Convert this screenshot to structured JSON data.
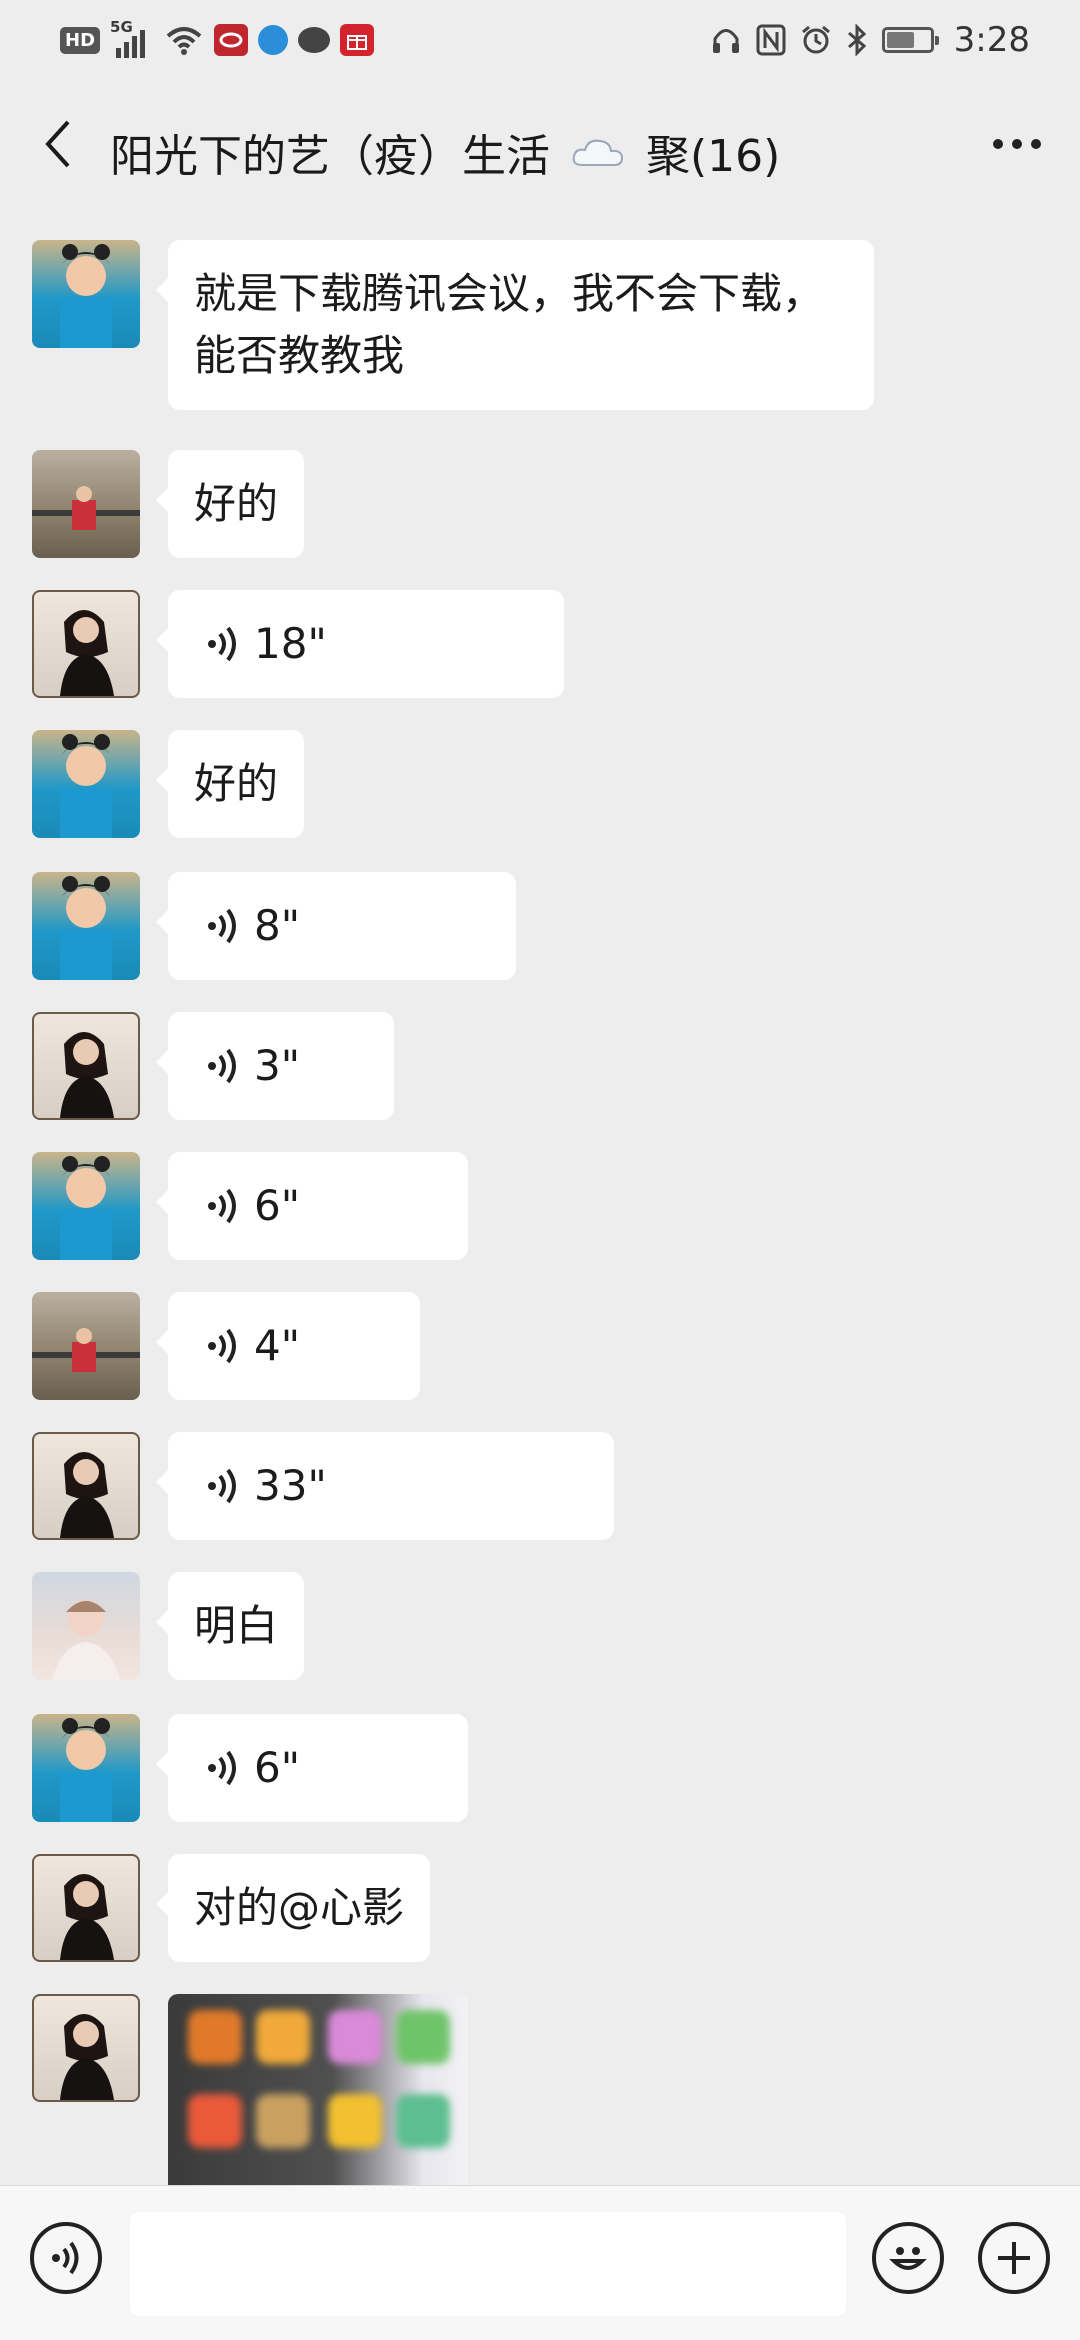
{
  "status_bar": {
    "network_badge": "HD",
    "network_type": "5G",
    "time": "3:28",
    "icons_left": [
      "signal-icon",
      "wifi-icon",
      "app-notification-icon",
      "browser-icon",
      "message-icon",
      "gift-app-icon"
    ],
    "icons_right": [
      "headphones-icon",
      "nfc-icon",
      "alarm-icon",
      "bluetooth-icon",
      "battery-icon"
    ]
  },
  "header": {
    "title": "阳光下的艺（疫）生活",
    "subtitle": "聚(16)",
    "title_emoji": "cloud-icon"
  },
  "messages": [
    {
      "sender": "avatar-boy-blue",
      "type": "text",
      "lines": [
        "就是下载腾讯会议，我不会下载，",
        "能否教教我"
      ]
    },
    {
      "sender": "avatar-child-balcony",
      "type": "text",
      "text": "好的"
    },
    {
      "sender": "avatar-woman-dark",
      "type": "voice",
      "duration": "18\""
    },
    {
      "sender": "avatar-boy-blue",
      "type": "text",
      "text": "好的"
    },
    {
      "sender": "avatar-boy-blue",
      "type": "voice",
      "duration": "8\""
    },
    {
      "sender": "avatar-woman-dark",
      "type": "voice",
      "duration": "3\""
    },
    {
      "sender": "avatar-boy-blue",
      "type": "voice",
      "duration": "6\""
    },
    {
      "sender": "avatar-child-balcony",
      "type": "voice",
      "duration": "4\""
    },
    {
      "sender": "avatar-woman-dark",
      "type": "voice",
      "duration": "33\""
    },
    {
      "sender": "avatar-girl-light",
      "type": "text",
      "text": "明白"
    },
    {
      "sender": "avatar-boy-blue",
      "type": "voice",
      "duration": "6\""
    },
    {
      "sender": "avatar-woman-dark",
      "type": "text",
      "text": "对的@心影"
    },
    {
      "sender": "avatar-woman-dark",
      "type": "image"
    }
  ],
  "input_bar": {
    "voice_button_icon": "voice-icon",
    "emoji_button_icon": "emoji-icon",
    "plus_button_icon": "plus-icon",
    "field_value": ""
  },
  "colors": {
    "background": "#ededed",
    "bubble": "#ffffff",
    "text": "#1b1b1b"
  }
}
